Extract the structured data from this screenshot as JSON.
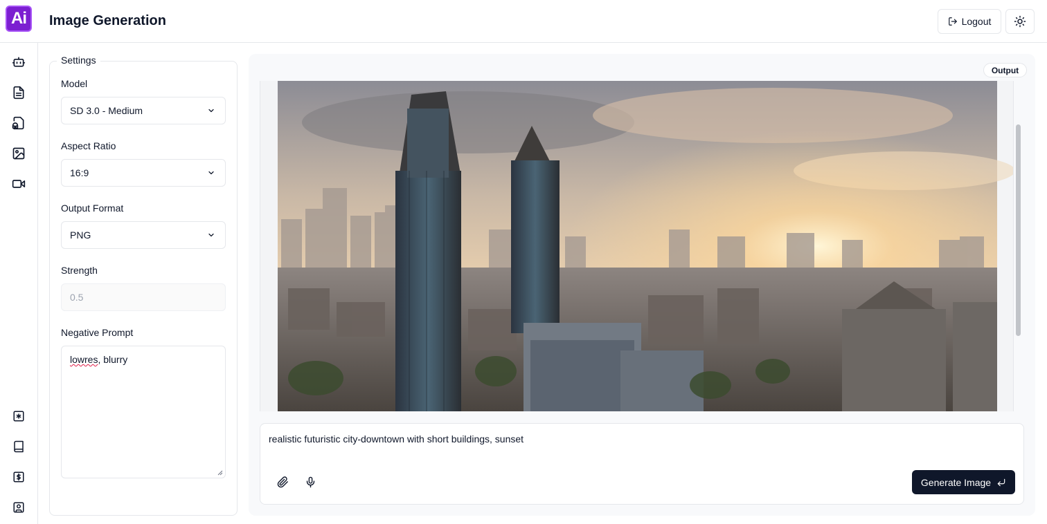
{
  "app": {
    "logo_text": "Ai",
    "title": "Image Generation"
  },
  "header": {
    "logout_label": "Logout",
    "theme_toggle_icon": "sun-icon"
  },
  "sidebar": {
    "top_items": [
      {
        "icon": "bot-icon"
      },
      {
        "icon": "document-icon"
      },
      {
        "icon": "audio-file-icon"
      },
      {
        "icon": "image-icon"
      },
      {
        "icon": "video-icon"
      }
    ],
    "bottom_items": [
      {
        "icon": "asterisk-icon"
      },
      {
        "icon": "book-icon"
      },
      {
        "icon": "dollar-icon"
      },
      {
        "icon": "contact-icon"
      }
    ]
  },
  "settings": {
    "legend": "Settings",
    "model": {
      "label": "Model",
      "value": "SD 3.0 - Medium"
    },
    "aspect_ratio": {
      "label": "Aspect Ratio",
      "value": "16:9"
    },
    "output_format": {
      "label": "Output Format",
      "value": "PNG"
    },
    "strength": {
      "label": "Strength",
      "placeholder": "0.5"
    },
    "negative_prompt": {
      "label": "Negative Prompt",
      "value_misspelled": "lowres",
      "value_rest": ", blurry"
    }
  },
  "output": {
    "badge": "Output",
    "image_alt": "generated image: futuristic city downtown at sunset"
  },
  "prompt": {
    "text": "realistic futuristic city-downtown with short buildings, sunset",
    "attach_icon": "paperclip-icon",
    "mic_icon": "microphone-icon",
    "generate_label": "Generate Image",
    "enter_icon": "enter-icon"
  },
  "colors": {
    "brand": "#7c1fd1",
    "button_dark": "#0f172a",
    "border": "#e5e7eb",
    "panel_bg": "#f8f9fb"
  }
}
